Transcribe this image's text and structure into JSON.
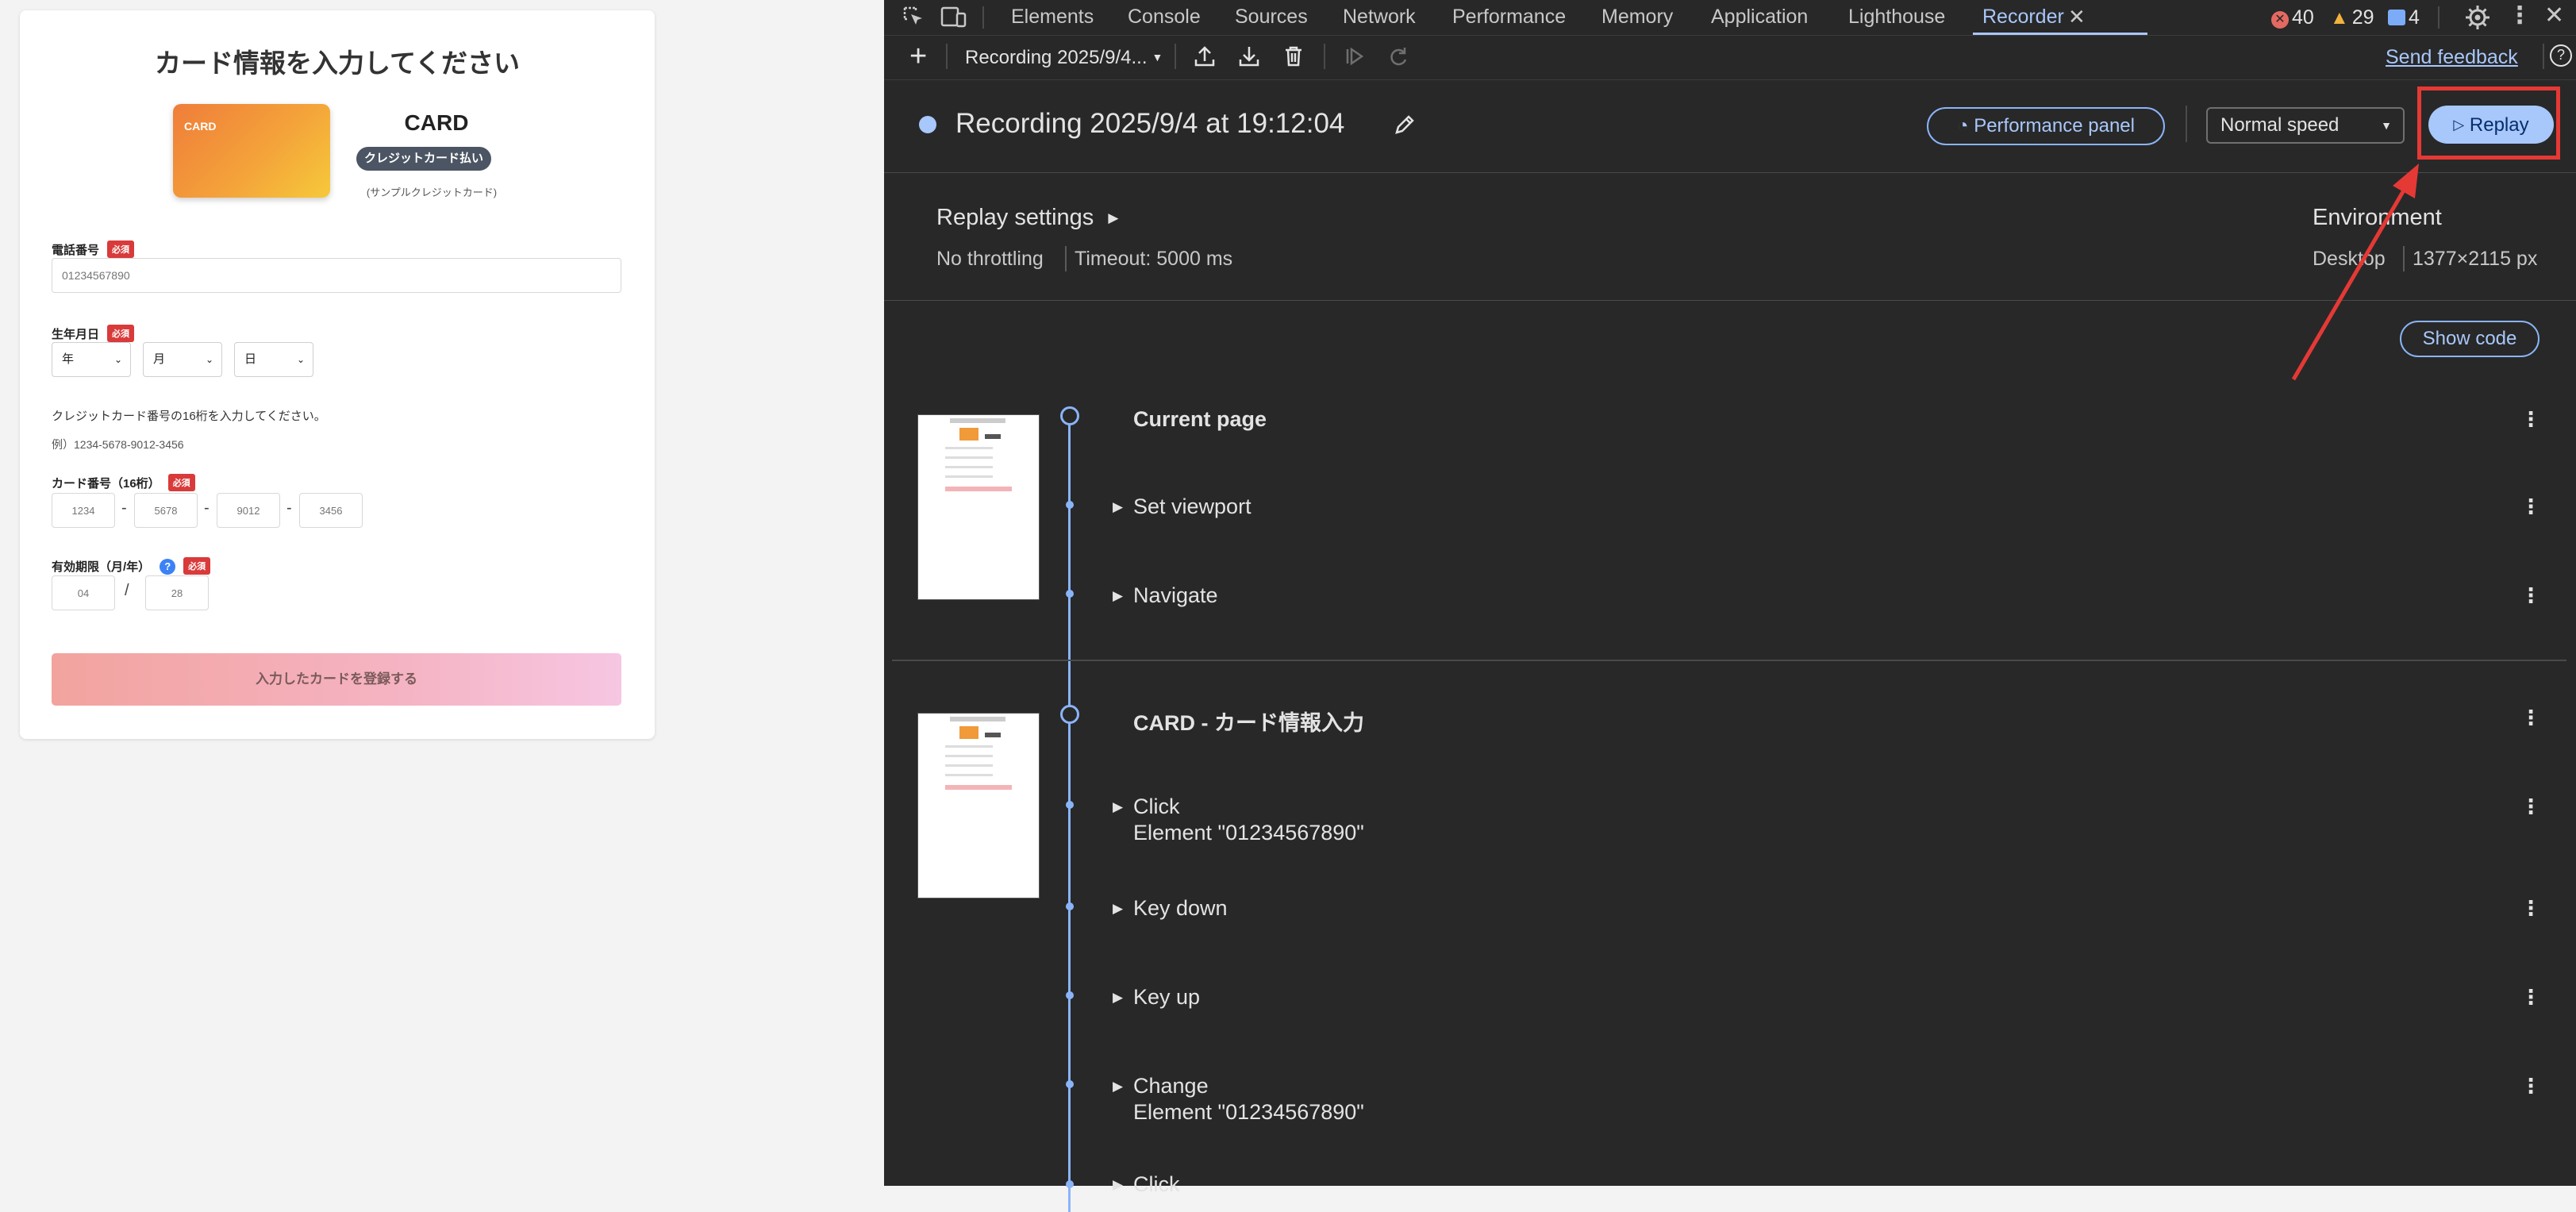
{
  "form": {
    "title": "カード情報を入力してください",
    "card_image_label": "CARD",
    "card_name": "CARD",
    "card_badge": "クレジットカード払い",
    "card_note": "(サンプルクレジットカード)",
    "required_badge": "必須",
    "phone_label": "電話番号",
    "phone_placeholder": "01234567890",
    "birthdate_label": "生年月日",
    "year_select": "年",
    "month_select": "月",
    "day_select": "日",
    "card_instruction": "クレジットカード番号の16桁を入力してください。",
    "card_example": "例）1234-5678-9012-3456",
    "card_number_label": "カード番号（16桁）",
    "card_number_placeholders": [
      "1234",
      "5678",
      "9012",
      "3456"
    ],
    "dash": "-",
    "expiry_label": "有効期限（月/年）",
    "help_icon": "?",
    "expiry_month_placeholder": "04",
    "expiry_year_placeholder": "28",
    "slash": "/",
    "submit_label": "入力したカードを登録する"
  },
  "devtools": {
    "tabs": [
      "Elements",
      "Console",
      "Sources",
      "Network",
      "Performance",
      "Memory",
      "Application",
      "Lighthouse",
      "Recorder"
    ],
    "active_tab": "Recorder",
    "counters": {
      "errors": "40",
      "warnings": "29",
      "messages": "4"
    },
    "toolbar": {
      "recording_select": "Recording 2025/9/4...",
      "send_feedback": "Send feedback"
    },
    "header": {
      "recording_title": "Recording 2025/9/4 at 19:12:04",
      "performance_panel": "Performance panel",
      "speed": "Normal speed",
      "replay": "Replay"
    },
    "settings": {
      "replay_settings": "Replay settings",
      "throttling": "No throttling",
      "timeout": "Timeout: 5000 ms",
      "environment": "Environment",
      "device": "Desktop",
      "viewport": "1377×2115 px"
    },
    "show_code": "Show code",
    "sections": [
      {
        "title": "Current page",
        "steps": [
          {
            "label": "Set viewport",
            "sub": ""
          },
          {
            "label": "Navigate",
            "sub": ""
          }
        ]
      },
      {
        "title": "CARD - カード情報入力",
        "steps": [
          {
            "label": "Click",
            "sub": "Element \"01234567890\""
          },
          {
            "label": "Key down",
            "sub": ""
          },
          {
            "label": "Key up",
            "sub": ""
          },
          {
            "label": "Change",
            "sub": "Element \"01234567890\""
          },
          {
            "label": "Click",
            "sub": ""
          }
        ]
      }
    ],
    "colors": {
      "accent": "#a8c7fa",
      "annotation": "#e53935",
      "background": "#282828"
    }
  }
}
